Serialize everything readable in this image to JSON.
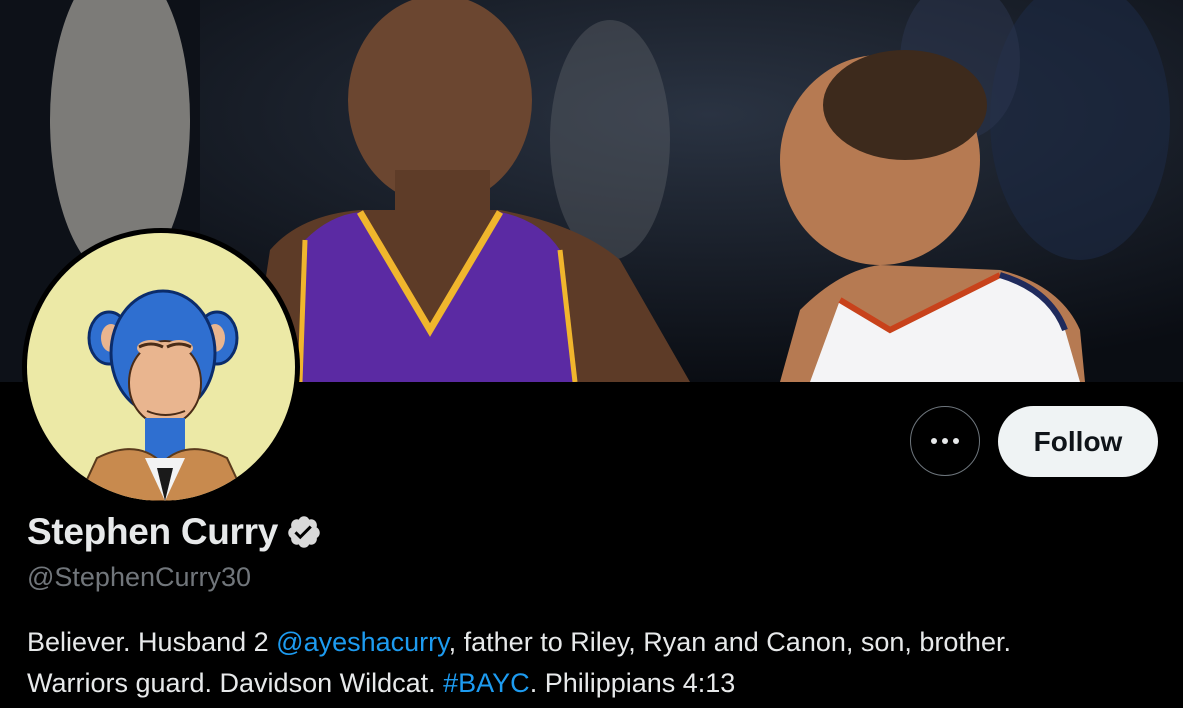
{
  "profile": {
    "display_name": "Stephen Curry",
    "handle": "@StephenCurry30",
    "verified": true,
    "verified_icon": "verified-badge-icon",
    "bio": {
      "part1": "Believer. Husband 2 ",
      "mention": "@ayeshacurry",
      "part2": ", father to Riley, Ryan and Canon, son, brother.",
      "line2_part1": "Warriors guard. Davidson Wildcat. ",
      "hashtag": "#BAYC",
      "line2_part2": ". Philippians 4:13"
    }
  },
  "actions": {
    "more_icon": "more-dots-icon",
    "follow_label": "Follow"
  },
  "colors": {
    "background": "#000000",
    "link": "#1d9bf0",
    "secondary_text": "#71767b",
    "follow_bg": "#eff3f4"
  }
}
